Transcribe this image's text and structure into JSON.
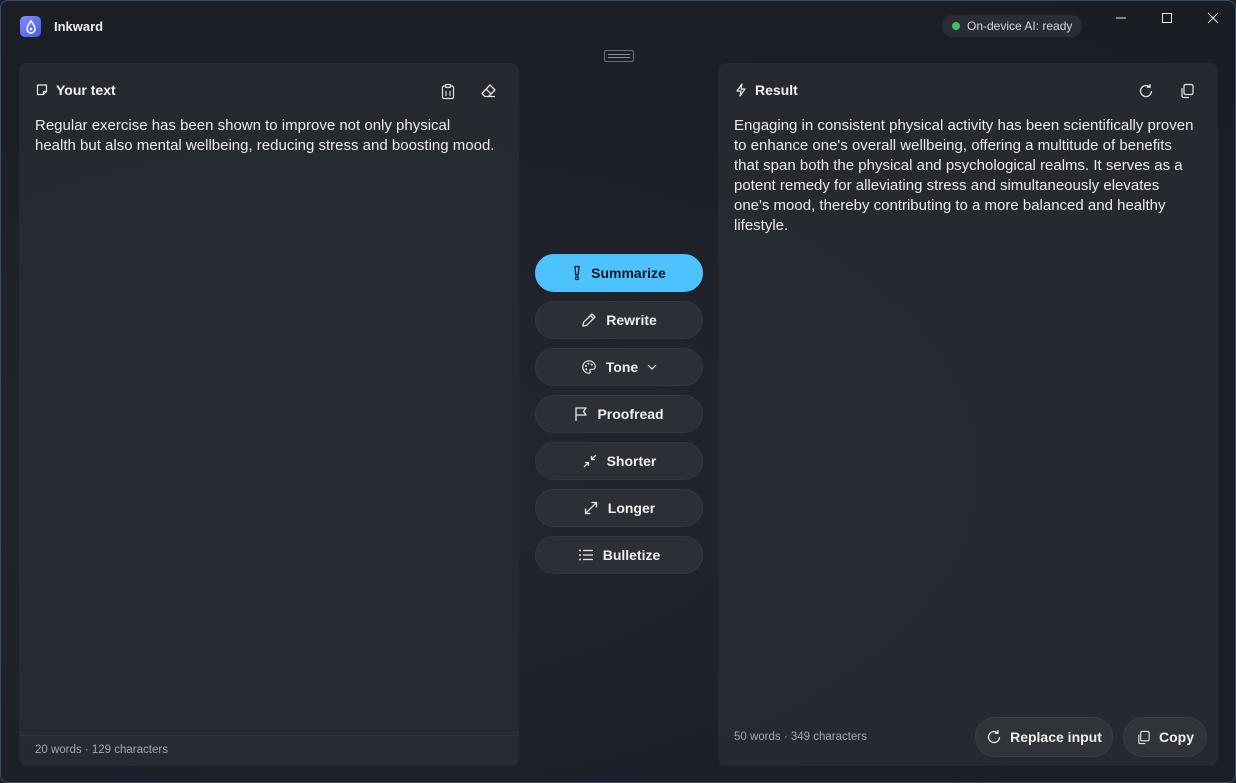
{
  "app": {
    "title": "Inkward",
    "status": "On-device AI: ready"
  },
  "input_panel": {
    "title": "Your text",
    "text": "Regular exercise has been shown to improve not only physical health but also mental wellbeing, reducing stress and boosting mood.",
    "stats": "20 words · 129 characters"
  },
  "actions": [
    {
      "label": "Summarize",
      "icon": "summarize-icon",
      "active": true
    },
    {
      "label": "Rewrite",
      "icon": "pencil-icon"
    },
    {
      "label": "Tone",
      "icon": "palette-icon",
      "dropdown": true
    },
    {
      "label": "Proofread",
      "icon": "flag-icon"
    },
    {
      "label": "Shorter",
      "icon": "shrink-icon"
    },
    {
      "label": "Longer",
      "icon": "expand-icon"
    },
    {
      "label": "Bulletize",
      "icon": "list-icon"
    }
  ],
  "result_panel": {
    "title": "Result",
    "text": "Engaging in consistent physical activity has been scientifically proven to enhance one's overall wellbeing, offering a multitude of benefits that span both the physical and psychological realms. It serves as a potent remedy for alleviating stress and simultaneously elevates one's mood, thereby contributing to a more balanced and healthy lifestyle.",
    "stats": "50 words · 349 characters",
    "replace_label": "Replace input",
    "copy_label": "Copy"
  },
  "colors": {
    "accent": "#4cc2ff",
    "status_ok": "#3cc65a",
    "logo": "#5b6bf5"
  }
}
